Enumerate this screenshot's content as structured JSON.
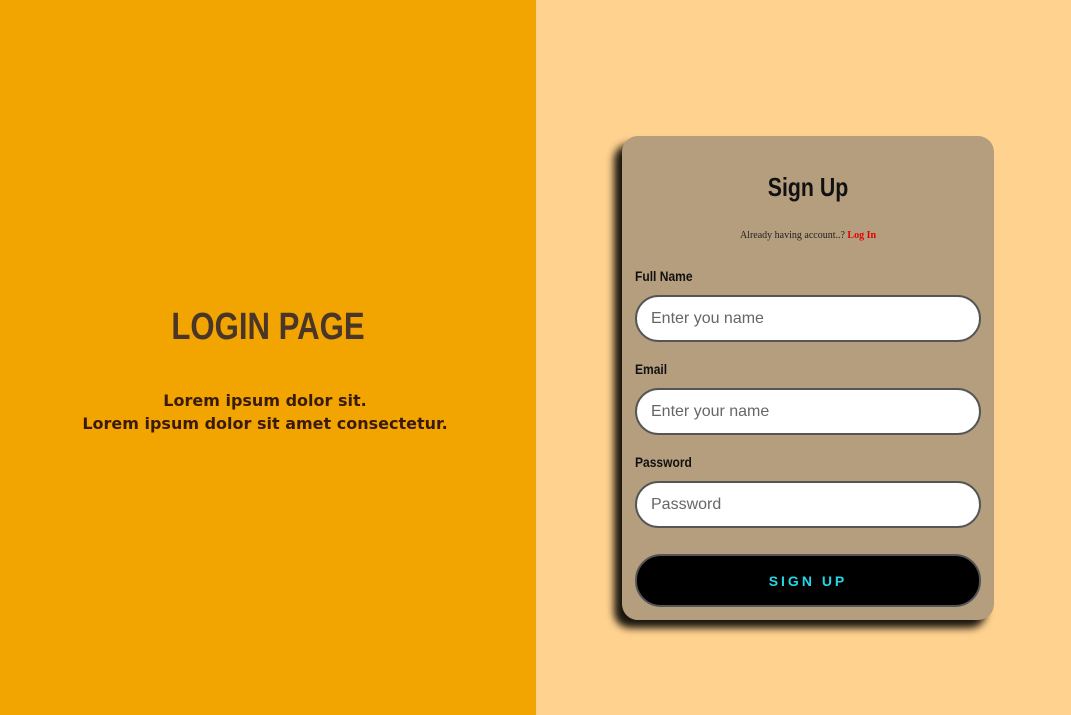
{
  "hero": {
    "title": "LOGIN PAGE",
    "subtitle_line1": "Lorem ipsum dolor sit.",
    "subtitle_line2": "Lorem ipsum dolor sit amet consectetur."
  },
  "signup": {
    "title": "Sign Up",
    "account_prompt": "Already having account..? ",
    "login_link": "Log In",
    "fields": [
      {
        "label": "Full Name",
        "placeholder": "Enter you name",
        "value": ""
      },
      {
        "label": "Email",
        "placeholder": "Enter your name",
        "value": ""
      },
      {
        "label": "Password",
        "placeholder": "Password",
        "value": ""
      }
    ],
    "submit_label": "SIGN UP"
  },
  "colors": {
    "left_bg": "#f2a500",
    "right_bg": "#ffd28f",
    "card_bg": "#b59e7e",
    "button_bg": "#000000",
    "button_text": "#22d8e8",
    "link": "#e00000"
  }
}
